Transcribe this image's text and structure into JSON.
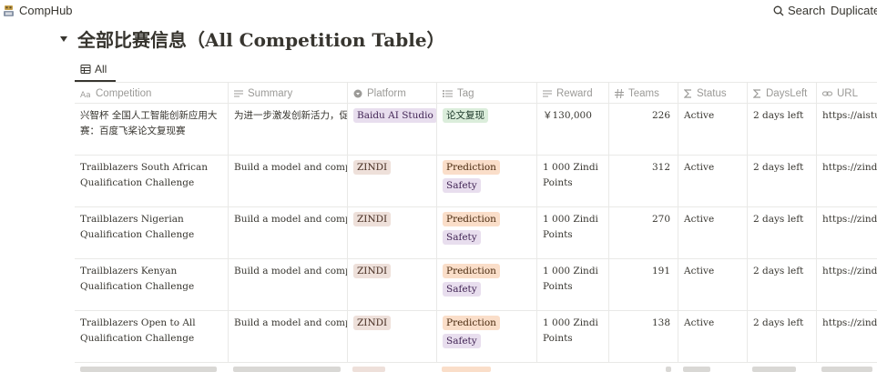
{
  "app": {
    "title": "CompHub",
    "search_label": "Search",
    "duplicate_label": "Duplicate"
  },
  "page": {
    "title": "全部比赛信息（All Competition Table）"
  },
  "view": {
    "tab_label": "All"
  },
  "columns": [
    {
      "label": "Competition",
      "icon": "text-aa-icon"
    },
    {
      "label": "Summary",
      "icon": "text-lines-icon"
    },
    {
      "label": "Platform",
      "icon": "select-circle-icon"
    },
    {
      "label": "Tag",
      "icon": "multiselect-list-icon"
    },
    {
      "label": "Reward",
      "icon": "text-lines-icon"
    },
    {
      "label": "Teams",
      "icon": "number-hash-icon"
    },
    {
      "label": "Status",
      "icon": "formula-sigma-icon"
    },
    {
      "label": "DaysLeft",
      "icon": "formula-sigma-icon"
    },
    {
      "label": "URL",
      "icon": "link-icon"
    }
  ],
  "rows": [
    {
      "competition": "兴智杯 全国人工智能创新应用大赛：百度飞桨论文复现赛",
      "summary": "为进一步激发创新活力，促",
      "platform": "Baidu AI Studio",
      "tags": [
        "论文复现"
      ],
      "reward": "￥130,000",
      "teams": "226",
      "status": "Active",
      "days_left": "2 days left",
      "url": "https://aistudio"
    },
    {
      "competition": "Trailblazers South African Qualification Challenge",
      "summary": "Build a model and complete",
      "platform": "ZINDI",
      "tags": [
        "Prediction",
        "Safety"
      ],
      "reward": "1 000 Zindi Points",
      "teams": "312",
      "status": "Active",
      "days_left": "2 days left",
      "url": "https://zindi.af"
    },
    {
      "competition": "Trailblazers Nigerian Qualification Challenge",
      "summary": "Build a model and complete",
      "platform": "ZINDI",
      "tags": [
        "Prediction",
        "Safety"
      ],
      "reward": "1 000 Zindi Points",
      "teams": "270",
      "status": "Active",
      "days_left": "2 days left",
      "url": "https://zindi.af"
    },
    {
      "competition": "Trailblazers Kenyan Qualification Challenge",
      "summary": "Build a model and complete",
      "platform": "ZINDI",
      "tags": [
        "Prediction",
        "Safety"
      ],
      "reward": "1 000 Zindi Points",
      "teams": "191",
      "status": "Active",
      "days_left": "2 days left",
      "url": "https://zindi.af"
    },
    {
      "competition": "Trailblazers Open to All Qualification Challenge",
      "summary": "Build a model and complete",
      "platform": "ZINDI",
      "tags": [
        "Prediction",
        "Safety"
      ],
      "reward": "1 000 Zindi Points",
      "teams": "138",
      "status": "Active",
      "days_left": "2 days left",
      "url": "https://zindi.af"
    }
  ],
  "tag_colors": {
    "论文复现": "#dbeddb",
    "Prediction": "#fadec9",
    "Safety": "#e8deee"
  },
  "platform_colors": {
    "Baidu AI Studio": "#e8deee",
    "ZINDI": "#eee0da"
  }
}
